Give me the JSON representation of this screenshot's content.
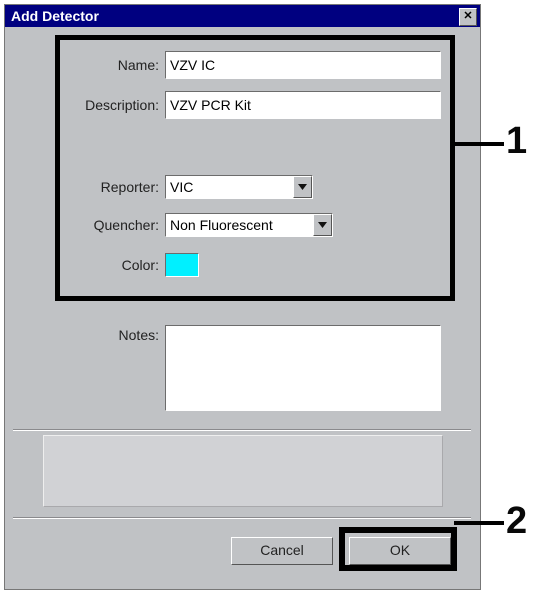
{
  "window": {
    "title": "Add Detector",
    "close_glyph": "✕"
  },
  "form": {
    "name_label": "Name:",
    "name_value": "VZV IC",
    "description_label": "Description:",
    "description_value": "VZV PCR Kit",
    "reporter_label": "Reporter:",
    "reporter_value": "VIC",
    "quencher_label": "Quencher:",
    "quencher_value": "Non Fluorescent",
    "color_label": "Color:",
    "color_value": "#00F0FF",
    "notes_label": "Notes:",
    "notes_value": ""
  },
  "buttons": {
    "cancel": "Cancel",
    "ok": "OK"
  },
  "annotations": {
    "one": "1",
    "two": "2"
  }
}
